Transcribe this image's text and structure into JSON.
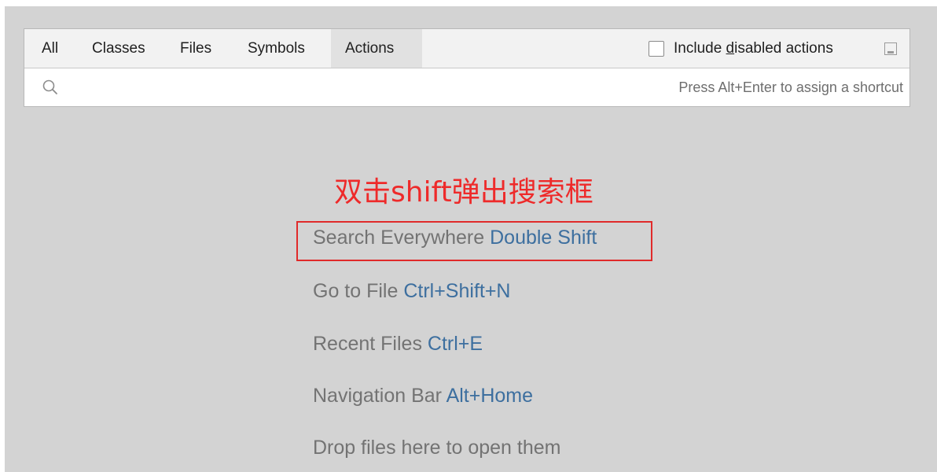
{
  "tabs": [
    {
      "label": "All"
    },
    {
      "label": "Classes"
    },
    {
      "label": "Files"
    },
    {
      "label": "Symbols"
    },
    {
      "label": "Actions",
      "active": true
    }
  ],
  "include_disabled": {
    "label_pre": "Include ",
    "label_mnemonic": "d",
    "label_post": "isabled actions",
    "checked": false
  },
  "search": {
    "value": "",
    "hint": "Press Alt+Enter to assign a shortcut"
  },
  "annotation": {
    "text": "双击shift弹出搜索框",
    "color": "#ee2a2a"
  },
  "tips": [
    {
      "text": "Search Everywhere",
      "shortcut": "Double Shift"
    },
    {
      "text": "Go to File",
      "shortcut": "Ctrl+Shift+N"
    },
    {
      "text": "Recent Files",
      "shortcut": "Ctrl+E"
    },
    {
      "text": "Navigation Bar",
      "shortcut": "Alt+Home"
    },
    {
      "text": "Drop files here to open them",
      "shortcut": ""
    }
  ],
  "colors": {
    "shortcut": "#3d6f9f",
    "tip_text": "#737373",
    "background": "#d3d3d3",
    "highlight_box": "#e02a2a"
  },
  "icons": {
    "search": "search-icon",
    "pin": "pin-window-icon"
  }
}
